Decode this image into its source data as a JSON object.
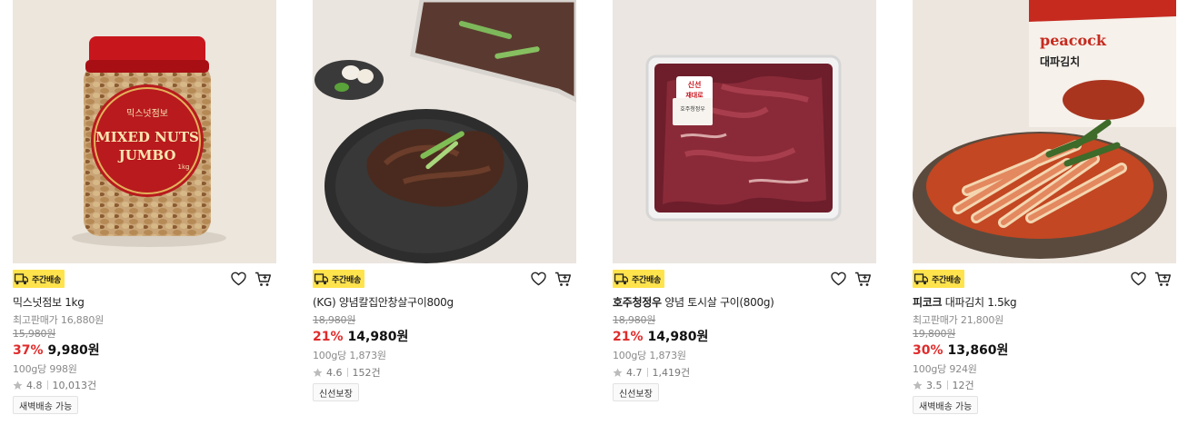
{
  "products": [
    {
      "badge": "주간배송",
      "brand": "",
      "name": "믹스넛점보 1kg",
      "best_price_label": "최고판매가 16,880원",
      "original_price": "15,980원",
      "discount": "37%",
      "price": "9,980원",
      "unit_price": "100g당 998원",
      "rating": "4.8",
      "reviews": "10,013건",
      "tag": "새벽배송 가능",
      "image_label_small": "믹스넛점보",
      "image_label_big1": "MIXED NUTS",
      "image_label_big2": "JUMBO",
      "image_label_weight": "1kg"
    },
    {
      "badge": "주간배송",
      "brand": "",
      "name": "(KG) 양념칼집안창살구이800g",
      "original_price": "18,980원",
      "discount": "21%",
      "price": "14,980원",
      "unit_price": "100g당 1,873원",
      "rating": "4.6",
      "reviews": "152건",
      "tag": "신선보장"
    },
    {
      "badge": "주간배송",
      "brand": "호주청정우",
      "name": " 양념 토시살 구이(800g)",
      "original_price": "18,980원",
      "discount": "21%",
      "price": "14,980원",
      "unit_price": "100g당 1,873원",
      "rating": "4.7",
      "reviews": "1,419건",
      "tag": "신선보장",
      "image_label_sticker1": "신선",
      "image_label_sticker2": "재대로",
      "image_label_pack": "호주청정우"
    },
    {
      "badge": "주간배송",
      "brand": "피코크",
      "name": " 대파김치 1.5kg",
      "best_price_label": "최고판매가 21,800원",
      "original_price": "19,800원",
      "discount": "30%",
      "price": "13,860원",
      "unit_price": "100g당 924원",
      "rating": "3.5",
      "reviews": "12건",
      "tag": "새벽배송 가능",
      "image_label_brand": "peacock",
      "image_label_product": "대파김치"
    }
  ],
  "icons": {
    "badge": "delivery-truck-icon",
    "wishlist": "heart-icon",
    "cart": "cart-icon",
    "rating": "star-icon"
  },
  "colors": {
    "badge_bg": "#ffe34d",
    "discount": "#e02b2b"
  }
}
